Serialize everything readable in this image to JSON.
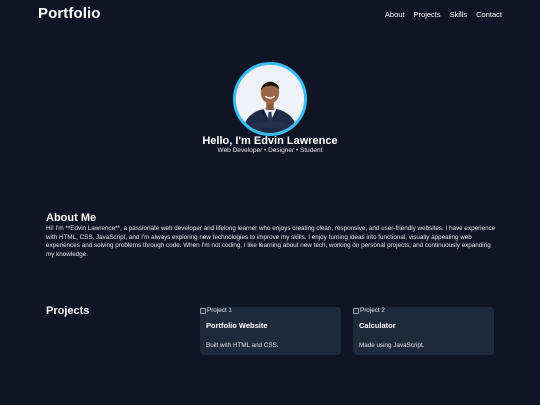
{
  "navbar": {
    "brand": "Portfolio",
    "links": [
      "About",
      "Projects",
      "Skills",
      "Contact"
    ]
  },
  "hero": {
    "name": "Hello, I'm Edvin Lawrence",
    "tagline": "Web Developer • Designer • Student",
    "avatar_icon": "profile-photo"
  },
  "about": {
    "title": "About Me",
    "text": "Hi! I'm **Edvin Lawrence**, a passionate web developer and lifelong learner who enjoys creating clean, responsive, and user-friendly websites. I have experience with HTML, CSS, JavaScript, and I'm always exploring new technologies to improve my skills. I enjoy turning ideas into functional, visually appealing web experiences and solving problems through code. When I'm not coding, I like learning about new tech, working on personal projects, and continuously expanding my knowledge."
  },
  "projects": {
    "title": "Projects",
    "items": [
      {
        "img_alt": "Project 1",
        "name": "Portfolio Website",
        "desc": "Built with HTML and CSS."
      },
      {
        "img_alt": "Project 2",
        "name": "Calculator",
        "desc": "Made using JavaScript."
      }
    ]
  },
  "colors": {
    "background": "#0e1525",
    "card": "#1e293b",
    "accent": "#38bdf8",
    "text": "#ffffff"
  }
}
